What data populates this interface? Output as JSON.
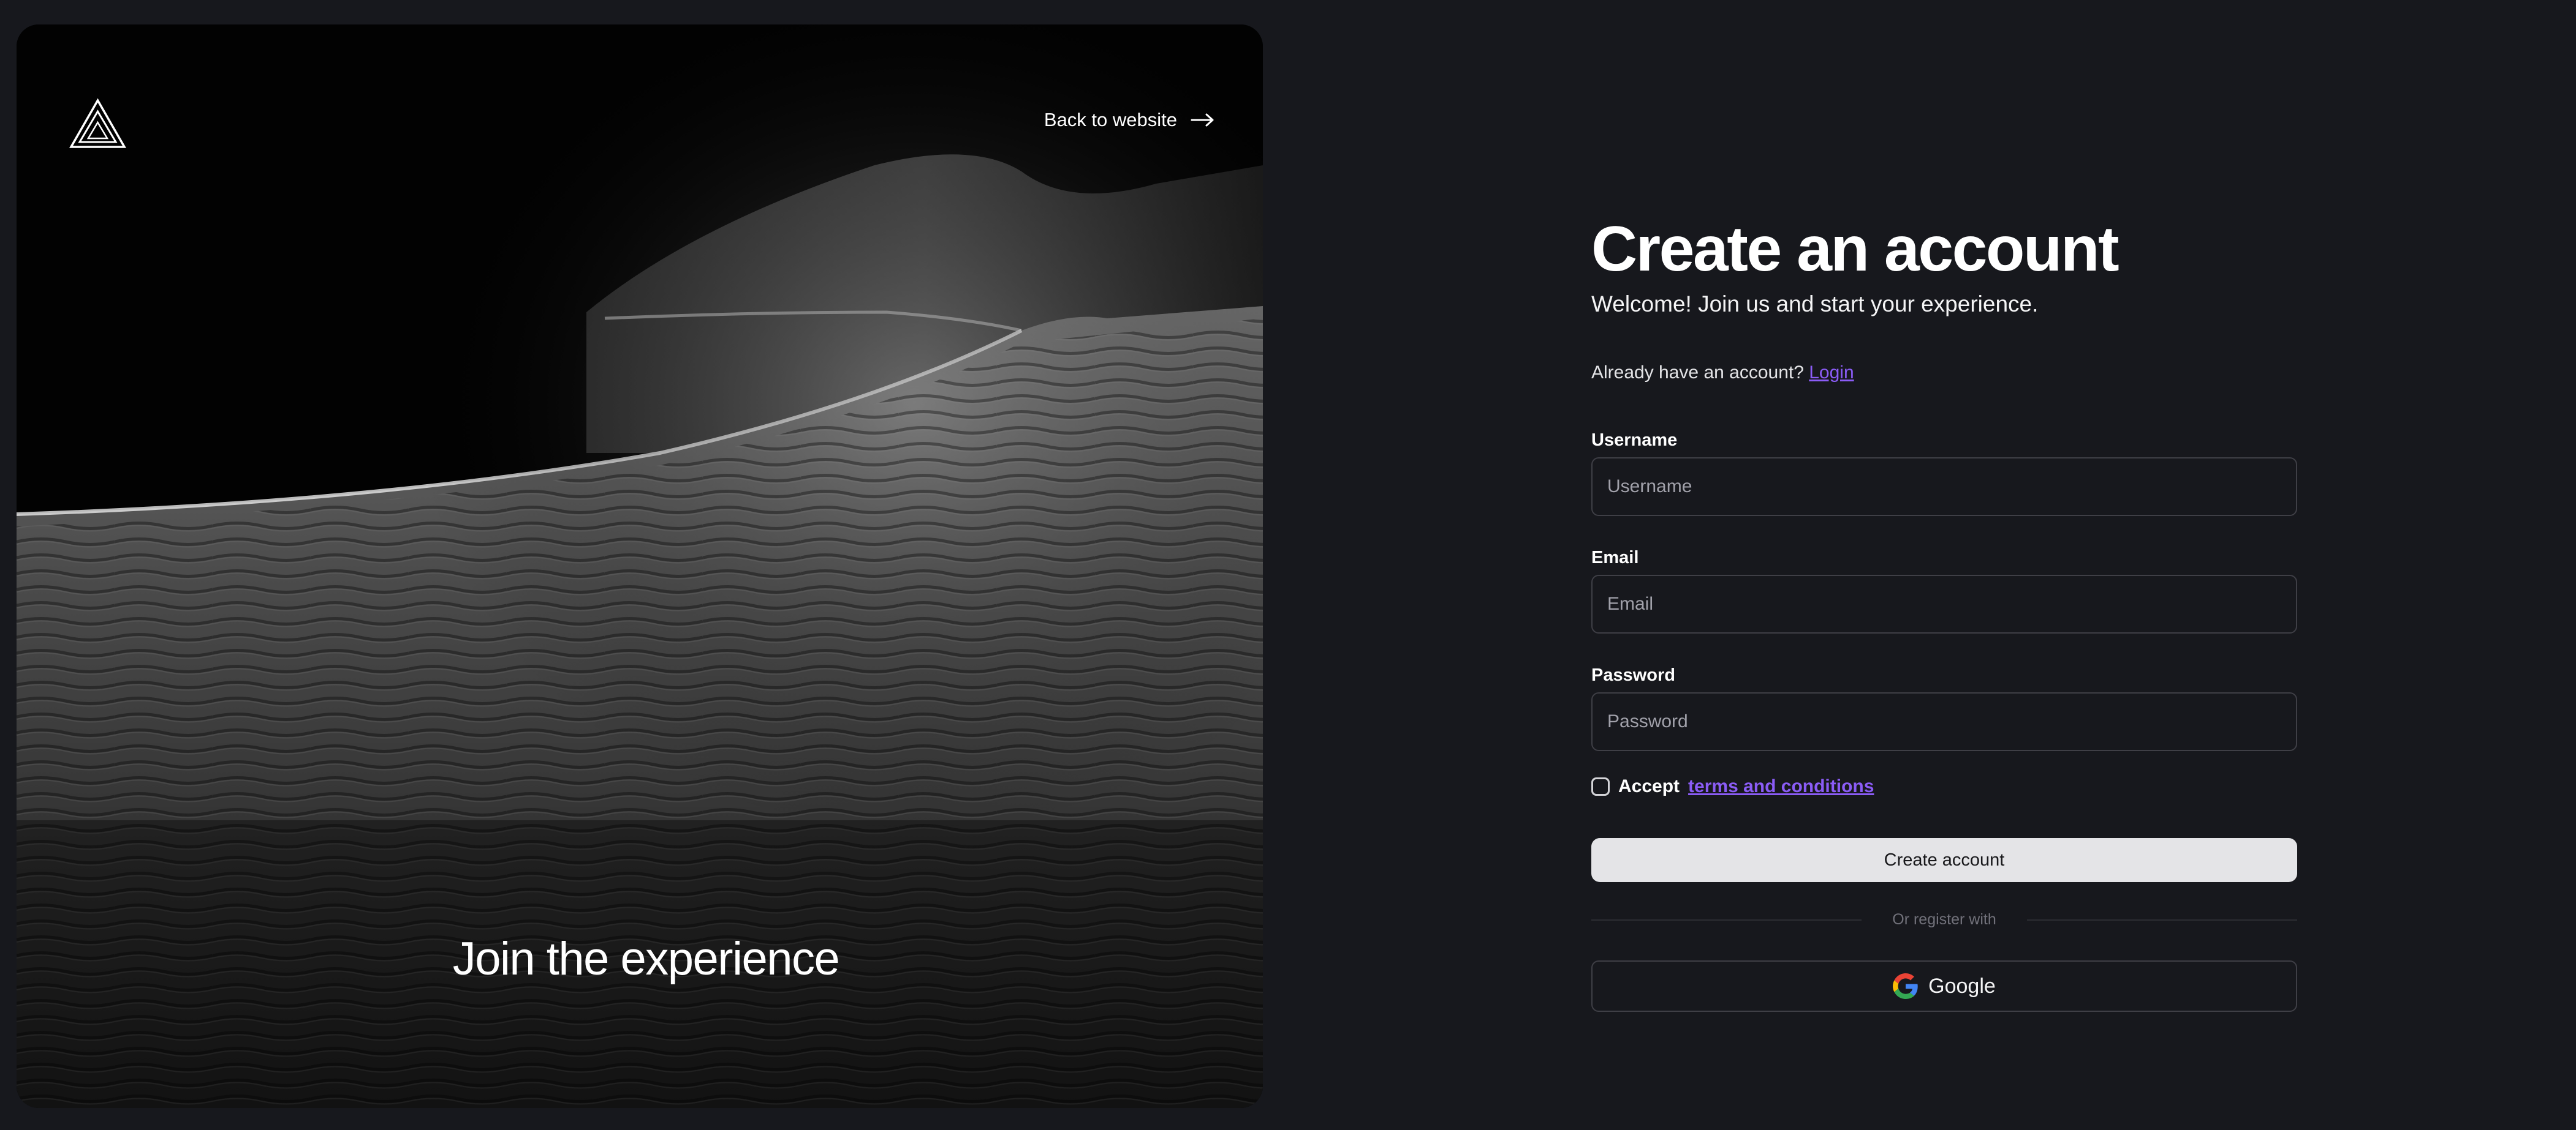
{
  "hero": {
    "back_link": "Back to website",
    "tagline": "Join the experience",
    "logo_icon": "triangle-logo-icon",
    "arrow_icon": "arrow-right-icon"
  },
  "form": {
    "title": "Create an account",
    "subtitle": "Welcome! Join us and start your experience.",
    "have_account_text": "Already have an account?",
    "login_link": "Login",
    "username": {
      "label": "Username",
      "placeholder": "Username",
      "value": ""
    },
    "email": {
      "label": "Email",
      "placeholder": "Email",
      "value": ""
    },
    "password": {
      "label": "Password",
      "placeholder": "Password",
      "value": ""
    },
    "terms": {
      "checked": false,
      "accept_text": "Accept",
      "link_text": "terms and conditions"
    },
    "submit_label": "Create account",
    "divider_text": "Or register with",
    "google_label": "Google",
    "google_icon": "google-icon"
  },
  "colors": {
    "background": "#17181d",
    "link_accent": "#8b5cf6",
    "primary_button": "#e4e4e7",
    "input_border": "#3f3f46"
  }
}
